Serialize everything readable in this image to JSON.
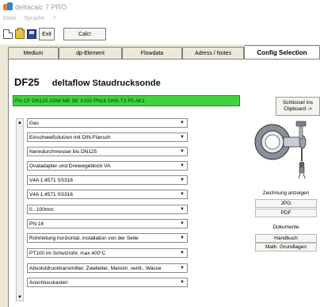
{
  "window": {
    "title": "deltacalc 7 PRO"
  },
  "menu": [
    "Datei",
    "Sprache",
    "?"
  ],
  "toolbar": {
    "exit_label": "Exit",
    "calc_label": "Calc!"
  },
  "tabs": [
    {
      "label": "Medium",
      "active": false
    },
    {
      "label": "dp-Element",
      "active": false
    },
    {
      "label": "Flowdata",
      "active": false
    },
    {
      "label": "Adress / Notes",
      "active": false
    },
    {
      "label": "Config Selection",
      "active": true
    }
  ],
  "header": {
    "code": "DF25",
    "name": "deltaflow Staudrucksonde"
  },
  "order_code": "FG CF DN125 ADW ME SE X100 PN16 OHS T3 P5 AK1",
  "clipboard_button": {
    "line1": "Schlüssel ins",
    "line2": "Clipboard ->"
  },
  "selects": [
    "Gas",
    "Einschweißstutzen mit DIN-Flansch",
    "Nenndurchmesser bis DN125",
    "Ovaladapter und Dreiwegeblock VA",
    "V4A 1.4571 SS316",
    "V4A 1.4571 SS316",
    "0...100mm",
    "PN 16",
    "Rohrleitung horizontal, installation von der Seite",
    "PT100 im Schutzrohr, max 400°C",
    "Absolutdrucktransmitter, Zweileiter, Manom. ventl., Wasse",
    "Anschlusskasten"
  ],
  "right_panel": {
    "drawing_label": "Zeichnung anzeigen",
    "jpg_label": "JPG",
    "pdf_label": "PDF",
    "documents_label": "Dokumente",
    "manual_label": "Handbuch",
    "math_label": "Math. Grundlagen"
  },
  "colors": {
    "code_bar": "#3fd43f",
    "background": "#ece9d8"
  }
}
